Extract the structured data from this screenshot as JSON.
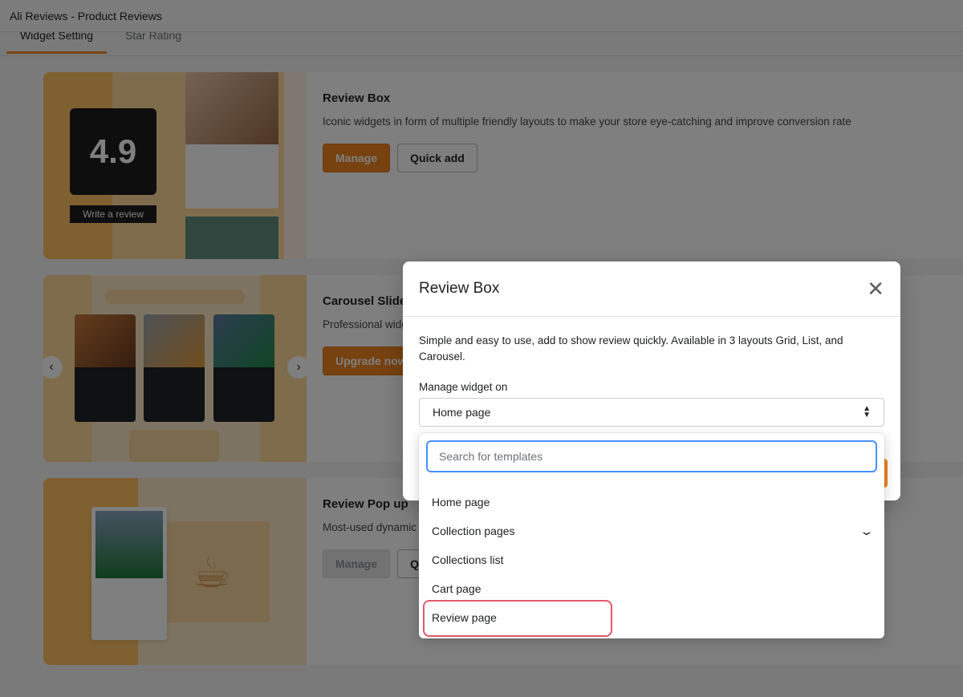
{
  "window": {
    "title": "Ali Reviews - Product Reviews"
  },
  "tabs": [
    {
      "label": "Widget Setting",
      "active": true
    },
    {
      "label": "Star Rating",
      "active": false
    }
  ],
  "cards": [
    {
      "title": "Review Box",
      "description": "Iconic widgets in form of multiple friendly layouts to make your store eye-catching and improve conversion rate",
      "primary": "Manage",
      "secondary": "Quick add",
      "thumb": {
        "rating": "4.9",
        "button": "Write a review"
      }
    },
    {
      "title": "Carousel Slider",
      "description": "Professional widget",
      "primary": "Upgrade now"
    },
    {
      "title": "Review Pop up",
      "description": "Most-used dynamic",
      "primary": "Manage",
      "secondary": "Quick add"
    }
  ],
  "modal": {
    "title": "Review Box",
    "description": "Simple and easy to use, add to show review quickly. Available in 3 layouts Grid, List, and Carousel.",
    "field_label": "Manage widget on",
    "selected": "Home page",
    "close_icon": "close-icon"
  },
  "dropdown": {
    "search_placeholder": "Search for templates",
    "options": [
      "Home page",
      "Collection pages",
      "Collections list",
      "Cart page",
      "Review page"
    ],
    "highlighted": "Review page"
  },
  "colors": {
    "accent": "#ee8420",
    "focus": "#458fff",
    "highlight": "#e05a6a"
  }
}
